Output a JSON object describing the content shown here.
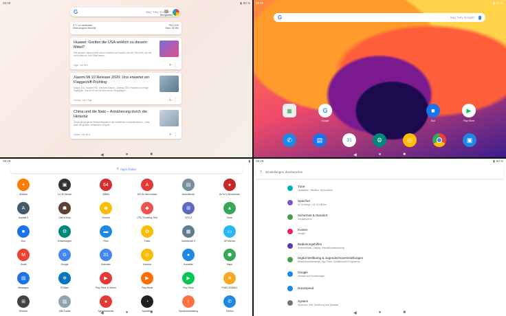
{
  "q1": {
    "time": "09:28",
    "battery": "94 %",
    "search_placeholder": "Sag \"Hey Google\"",
    "news_label": "Neuigkeiten",
    "weather": {
      "temp": "3 °C in Landkaiser",
      "desc": "Überwiegend bewölkt",
      "place": "PIS LINZ",
      "sub": "Stau: 34 Min"
    },
    "cards": [
      {
        "title": "Huawei: Greifen die USA wirklich zu diesem Mittel?",
        "snippet": "Wie geplant, dass es jetzt schon schlecht um Huawei und die USA steht, die seit schon fast ein Jahr Streit haben...",
        "src": "Giga · vor 30 h"
      },
      {
        "title": "Xiaomi Mi 10 Release 2020: Uns erwartet ein Flaggschiff-Frühling",
        "snippet": "Galaxy S11, Huawei P40, und jetzt Xiaomi – Anfang 2020 erwartet uns einige Highlights. Das Mi 10 will mit dem neuen Snapdragon...",
        "src": "Curved · vor 1 Tag"
      },
      {
        "title": "China und die Nato – Annäherung durch die Hintertür",
        "snippet": "China gilt als gerne Wirtschaftspartner der westlichen Industrienationen – aber auch als größter militärischer Gegner...",
        "src": "Cicero · vor 16 h"
      }
    ]
  },
  "q2": {
    "time": "09:29",
    "battery": "94 %",
    "search_placeholder": "Sag \"Hey Google\"",
    "apps": [
      {
        "label": "",
        "icon": "folder-icon"
      },
      {
        "label": "Google",
        "icon": "google-icon"
      },
      {
        "label": "Duo",
        "icon": "duo-icon"
      },
      {
        "label": "Play Store",
        "icon": "play-store-icon"
      }
    ],
    "dock": [
      "phone-icon",
      "messages-icon",
      "calendar-icon",
      "settings-icon",
      "camera-icon",
      "chrome-icon",
      "photos-icon"
    ]
  },
  "q3": {
    "time": "09:29",
    "search_label": "Apps finden",
    "apps": [
      {
        "label": "3DMark",
        "color": "#ff7a00",
        "glyph": "✦"
      },
      {
        "label": "3.1 3D Bench",
        "color": "#333333",
        "glyph": "▣"
      },
      {
        "label": "3DB64",
        "color": "#d32f2f",
        "glyph": "64"
      },
      {
        "label": "AiTuTu Benchmark",
        "color": "#e53935",
        "glyph": "A"
      },
      {
        "label": "AndroBench",
        "color": "#78909c",
        "glyph": "▤"
      },
      {
        "label": "AnTuTu Benchmark",
        "color": "#c62828",
        "glyph": "●"
      },
      {
        "label": "Asphalt 9",
        "color": "#455a64",
        "glyph": "A"
      },
      {
        "label": "Call of Duty",
        "color": "#5d4037",
        "glyph": "☗"
      },
      {
        "label": "Chrome",
        "color": "#fbbc05",
        "glyph": "◉"
      },
      {
        "label": "CPU Throttling Test",
        "color": "#ef5350",
        "glyph": "◆"
      },
      {
        "label": "CPU-Z",
        "color": "#5c6bc0",
        "glyph": "⊞"
      },
      {
        "label": "Drive",
        "color": "#34a853",
        "glyph": "▲"
      },
      {
        "label": "Duo",
        "color": "#1a73e8",
        "glyph": "■"
      },
      {
        "label": "Einstellungen",
        "color": "#00897b",
        "glyph": "⚙"
      },
      {
        "label": "Files",
        "color": "#1e88e5",
        "glyph": "▬"
      },
      {
        "label": "Fotos",
        "color": "#fbbc05",
        "glyph": "✿"
      },
      {
        "label": "Geekbench 5",
        "color": "#607d8b",
        "glyph": "▦"
      },
      {
        "label": "GFXBench",
        "color": "#29b6f6",
        "glyph": "▭"
      },
      {
        "label": "Gmail",
        "color": "#ea4335",
        "glyph": "M"
      },
      {
        "label": "Google",
        "color": "#4285f4",
        "glyph": "G"
      },
      {
        "label": "Kalender",
        "color": "#4285f4",
        "glyph": "31"
      },
      {
        "label": "Kamera",
        "color": "#fbbc05",
        "glyph": "◎"
      },
      {
        "label": "Kontakte",
        "color": "#1e88e5",
        "glyph": "●"
      },
      {
        "label": "Maps",
        "color": "#34a853",
        "glyph": "⬢"
      },
      {
        "label": "Messages",
        "color": "#1a73e8",
        "glyph": "▤"
      },
      {
        "label": "PCMark",
        "color": "#0277bd",
        "glyph": "❄"
      },
      {
        "label": "Play Filme & Serien",
        "color": "#e53935",
        "glyph": "▶"
      },
      {
        "label": "Play Musik",
        "color": "#ff6d00",
        "glyph": "▶"
      },
      {
        "label": "Play Store",
        "color": "#00c853",
        "glyph": "▶"
      },
      {
        "label": "PUBG MOBILE",
        "color": "#f9a825",
        "glyph": "✕"
      },
      {
        "label": "Rechner",
        "color": "#424242",
        "glyph": "⊞"
      },
      {
        "label": "SIM-Toolkit",
        "color": "#90a4ae",
        "glyph": "▥"
      },
      {
        "label": "Sprachrekorder",
        "color": "#e53935",
        "glyph": "●"
      },
      {
        "label": "Speedtest",
        "color": "#212121",
        "glyph": "◔"
      },
      {
        "label": "Speicherbelastung",
        "color": "#ff7043",
        "glyph": "↑"
      },
      {
        "label": "Telefon",
        "color": "#1e88e5",
        "glyph": "✆"
      }
    ]
  },
  "q4": {
    "time": "09:29",
    "battery": "93 %",
    "search_placeholder": "Einstellungen durchsuchen",
    "items": [
      {
        "title": "Töne",
        "sub": "Lautstärke, Vibration, Nicht stören",
        "color": "#00acc1",
        "icon": "sound-icon"
      },
      {
        "title": "Speicher",
        "sub": "31 % belegt – 44,74 GB frei",
        "color": "#7e57c2",
        "icon": "storage-icon"
      },
      {
        "title": "Sicherheit & Standort",
        "sub": "Displaysperre",
        "color": "#43a047",
        "icon": "lock-icon"
      },
      {
        "title": "Konten",
        "sub": "Google",
        "color": "#e91e63",
        "icon": "account-icon"
      },
      {
        "title": "Bedienungshilfen",
        "sub": "Screenreader, Display, Interaktionssteuerung",
        "color": "#5e35b1",
        "icon": "accessibility-icon"
      },
      {
        "title": "Digital Wellbeing & Jugendschutzeinstellungen",
        "sub": "Bildschirmzeitanzeige, App-Timer, Schlafenszeit-Programme",
        "color": "#43a047",
        "icon": "wellbeing-icon"
      },
      {
        "title": "Google",
        "sub": "Dienste und Einstellungen",
        "color": "#1e88e5",
        "icon": "google-icon"
      },
      {
        "title": "DuraSpeed",
        "sub": "",
        "color": "#1e88e5",
        "icon": "speed-icon"
      },
      {
        "title": "System",
        "sub": "Sprachen, Zeit, Sicherung und Updates",
        "color": "#757575",
        "icon": "info-icon"
      }
    ]
  }
}
